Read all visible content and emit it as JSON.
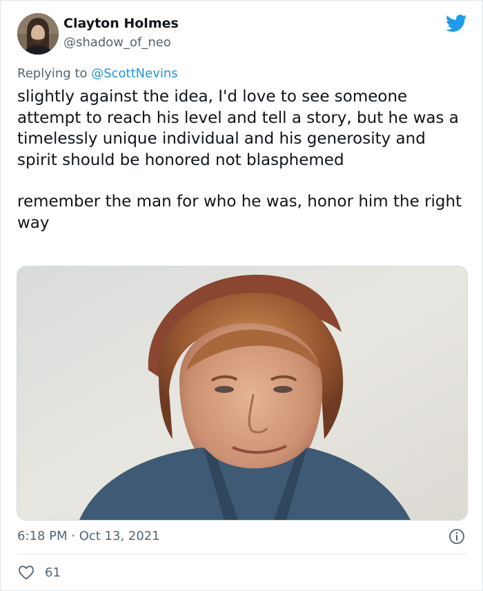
{
  "author": {
    "name": "Clayton Holmes",
    "handle": "@shadow_of_neo"
  },
  "reply": {
    "prefix": "Replying to ",
    "mention": "@ScottNevins"
  },
  "tweet": {
    "paragraph1": "slightly against the idea, I'd love to see someone attempt to reach his level and tell a story, but he was a timelessly unique individual and his generosity and spirit should be honored not blasphemed",
    "paragraph2": "remember the man for who he was, honor him the right way"
  },
  "meta": {
    "timestamp": "6:18 PM · Oct 13, 2021",
    "likes": "61"
  },
  "icons": {
    "logo": "twitter-bird-icon",
    "info": "info-icon",
    "like": "heart-icon"
  },
  "colors": {
    "brand": "#1d9bf0",
    "mention": "#1b95e0",
    "secondary_text": "#536471",
    "primary_text": "#0f1419"
  }
}
